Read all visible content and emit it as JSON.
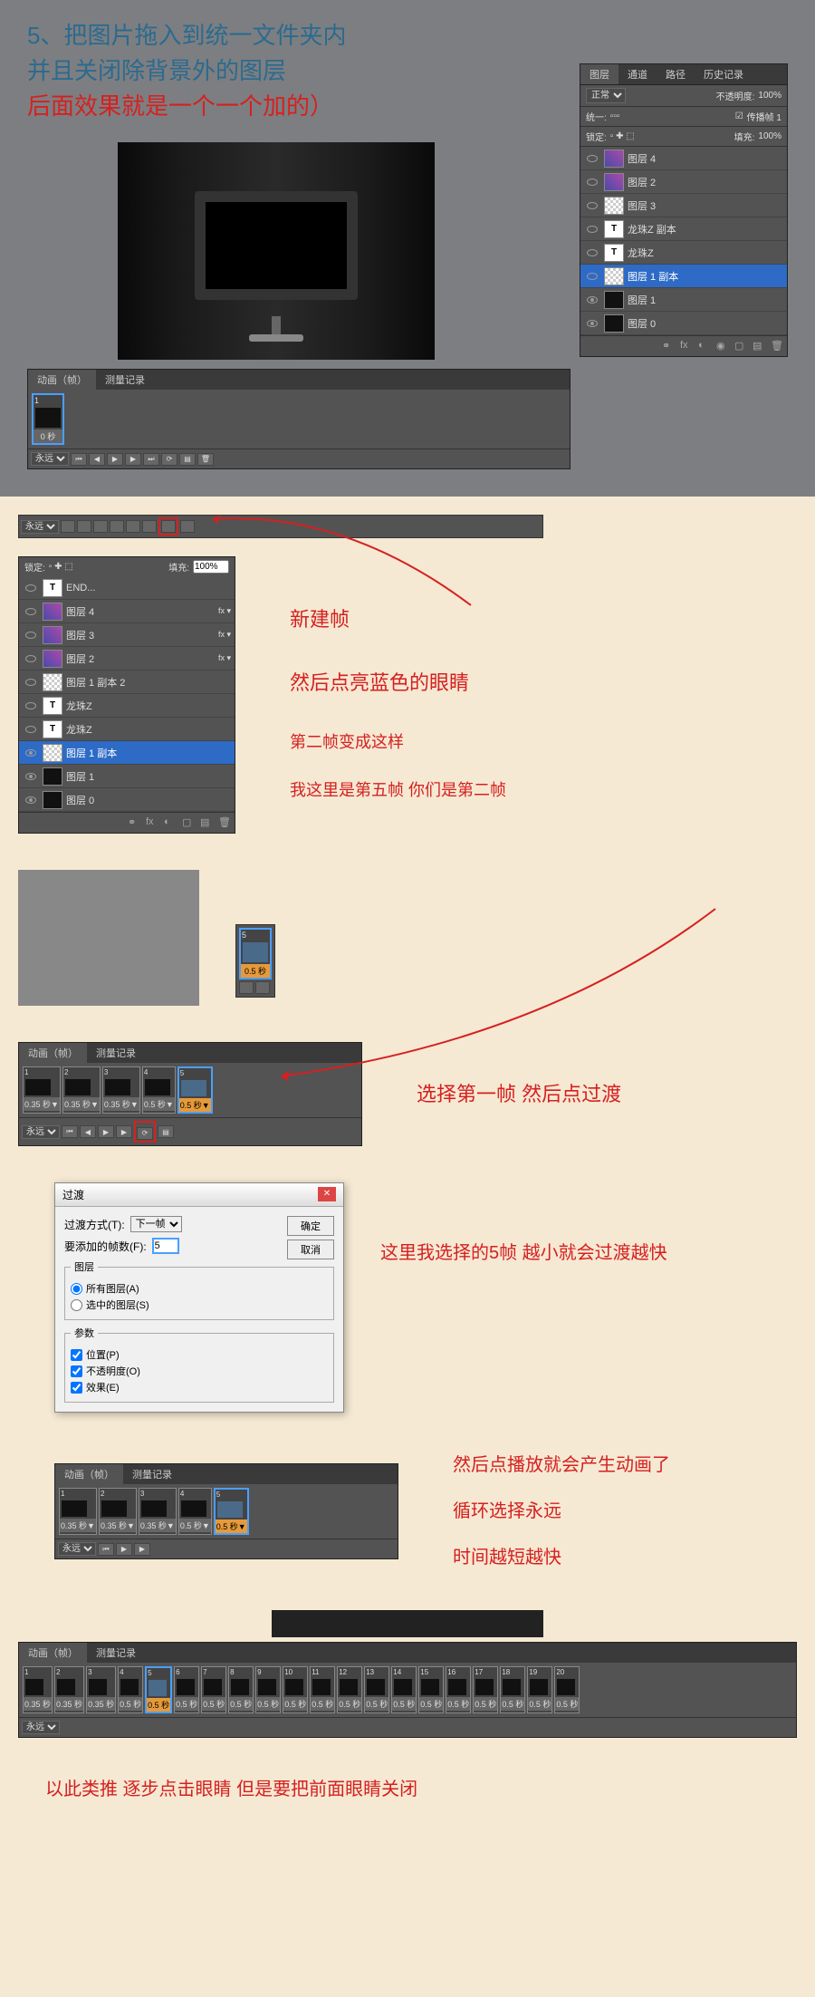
{
  "section1": {
    "line1": "5、把图片拖入到统一文件夹内",
    "line2": "并且关闭除背景外的图层",
    "line3": "后面效果就是一个一个加的）"
  },
  "panel1": {
    "tabs": [
      "图层",
      "通道",
      "路径",
      "历史记录"
    ],
    "mode": "正常",
    "opacityLabel": "不透明度:",
    "opacityVal": "100%",
    "unifyLabel": "统一:",
    "propLabel": "传播帧 1",
    "lockLabel": "锁定:",
    "fillLabel": "填充:",
    "fillVal": "100%",
    "layers": [
      {
        "name": "图层 4",
        "thumb": "img",
        "eye": false
      },
      {
        "name": "图层 2",
        "thumb": "img",
        "eye": false
      },
      {
        "name": "图层 3",
        "thumb": "pattern",
        "eye": false
      },
      {
        "name": "龙珠Z 副本",
        "thumb": "text",
        "eye": false
      },
      {
        "name": "龙珠Z",
        "thumb": "text",
        "eye": false
      },
      {
        "name": "图层 1 副本",
        "thumb": "pattern",
        "eye": false,
        "sel": true
      },
      {
        "name": "图层 1",
        "thumb": "tv",
        "eye": true
      },
      {
        "name": "图层 0",
        "thumb": "tv",
        "eye": true
      }
    ]
  },
  "anim1": {
    "tabs": [
      "动画（帧）",
      "测量记录"
    ],
    "frames": [
      {
        "n": "1",
        "t": "0 秒",
        "sel": true
      }
    ],
    "loop": "永远"
  },
  "section2": {
    "ann1": "新建帧",
    "ann2": "然后点亮蓝色的眼睛",
    "ann3": "第二帧变成这样",
    "ann4": "我这里是第五帧 你们是第二帧",
    "loop": "永远",
    "lockLabel": "锁定:",
    "fillLabel": "填充:",
    "fillVal": "100%",
    "layers": [
      {
        "name": "END...",
        "thumb": "text",
        "eye": false
      },
      {
        "name": "图层 4",
        "thumb": "img",
        "eye": false,
        "fx": true
      },
      {
        "name": "图层 3",
        "thumb": "img",
        "eye": false,
        "fx": true
      },
      {
        "name": "图层 2",
        "thumb": "img",
        "eye": false,
        "fx": true
      },
      {
        "name": "图层 1 副本 2",
        "thumb": "pattern",
        "eye": false
      },
      {
        "name": "龙珠Z",
        "thumb": "text",
        "eye": false
      },
      {
        "name": "龙珠Z",
        "thumb": "text",
        "eye": false
      },
      {
        "name": "图层 1 副本",
        "thumb": "pattern",
        "eye": true,
        "sel": true
      },
      {
        "name": "图层 1",
        "thumb": "tv",
        "eye": true
      },
      {
        "name": "图层 0",
        "thumb": "tv",
        "eye": true
      }
    ]
  },
  "frame5": {
    "n": "5",
    "t": "0.5 秒"
  },
  "section4": {
    "ann": "选择第一帧 然后点过渡",
    "tabs": [
      "动画（帧）",
      "测量记录"
    ],
    "frames": [
      {
        "n": "1",
        "t": "0.35 秒▼"
      },
      {
        "n": "2",
        "t": "0.35 秒▼"
      },
      {
        "n": "3",
        "t": "0.35 秒▼"
      },
      {
        "n": "4",
        "t": "0.5 秒▼"
      },
      {
        "n": "5",
        "t": "0.5 秒▼",
        "sel": true
      }
    ],
    "loop": "永远"
  },
  "dialog": {
    "title": "过渡",
    "methodLabel": "过渡方式(T):",
    "methodVal": "下一帧",
    "framesLabel": "要添加的帧数(F):",
    "framesVal": "5",
    "ok": "确定",
    "cancel": "取消",
    "layersLegend": "图层",
    "allLayers": "所有图层(A)",
    "selLayers": "选中的图层(S)",
    "paramsLegend": "参数",
    "position": "位置(P)",
    "opacity": "不透明度(O)",
    "effects": "效果(E)",
    "ann": "这里我选择的5帧   越小就会过渡越快"
  },
  "section5": {
    "ann1": "然后点播放就会产生动画了",
    "ann2": "循环选择永远",
    "ann3": "时间越短越快",
    "tabs": [
      "动画（帧）",
      "测量记录"
    ],
    "frames": [
      {
        "n": "1",
        "t": "0.35 秒▼"
      },
      {
        "n": "2",
        "t": "0.35 秒▼"
      },
      {
        "n": "3",
        "t": "0.35 秒▼"
      },
      {
        "n": "4",
        "t": "0.5 秒▼"
      },
      {
        "n": "5",
        "t": "0.5 秒▼",
        "sel": true
      }
    ],
    "loop": "永远"
  },
  "section6": {
    "tabs": [
      "动画（帧）",
      "测量记录"
    ],
    "frames": [
      {
        "n": "1",
        "t": "0.35 秒"
      },
      {
        "n": "2",
        "t": "0.35 秒"
      },
      {
        "n": "3",
        "t": "0.35 秒"
      },
      {
        "n": "4",
        "t": "0.5 秒"
      },
      {
        "n": "5",
        "t": "0.5 秒",
        "sel": true
      },
      {
        "n": "6",
        "t": "0.5 秒"
      },
      {
        "n": "7",
        "t": "0.5 秒"
      },
      {
        "n": "8",
        "t": "0.5 秒"
      },
      {
        "n": "9",
        "t": "0.5 秒"
      },
      {
        "n": "10",
        "t": "0.5 秒"
      },
      {
        "n": "11",
        "t": "0.5 秒"
      },
      {
        "n": "12",
        "t": "0.5 秒"
      },
      {
        "n": "13",
        "t": "0.5 秒"
      },
      {
        "n": "14",
        "t": "0.5 秒"
      },
      {
        "n": "15",
        "t": "0.5 秒"
      },
      {
        "n": "16",
        "t": "0.5 秒"
      },
      {
        "n": "17",
        "t": "0.5 秒"
      },
      {
        "n": "18",
        "t": "0.5 秒"
      },
      {
        "n": "19",
        "t": "0.5 秒"
      },
      {
        "n": "20",
        "t": "0.5 秒"
      }
    ],
    "loop": "永远"
  },
  "final": "以此类推 逐步点击眼睛 但是要把前面眼睛关闭"
}
